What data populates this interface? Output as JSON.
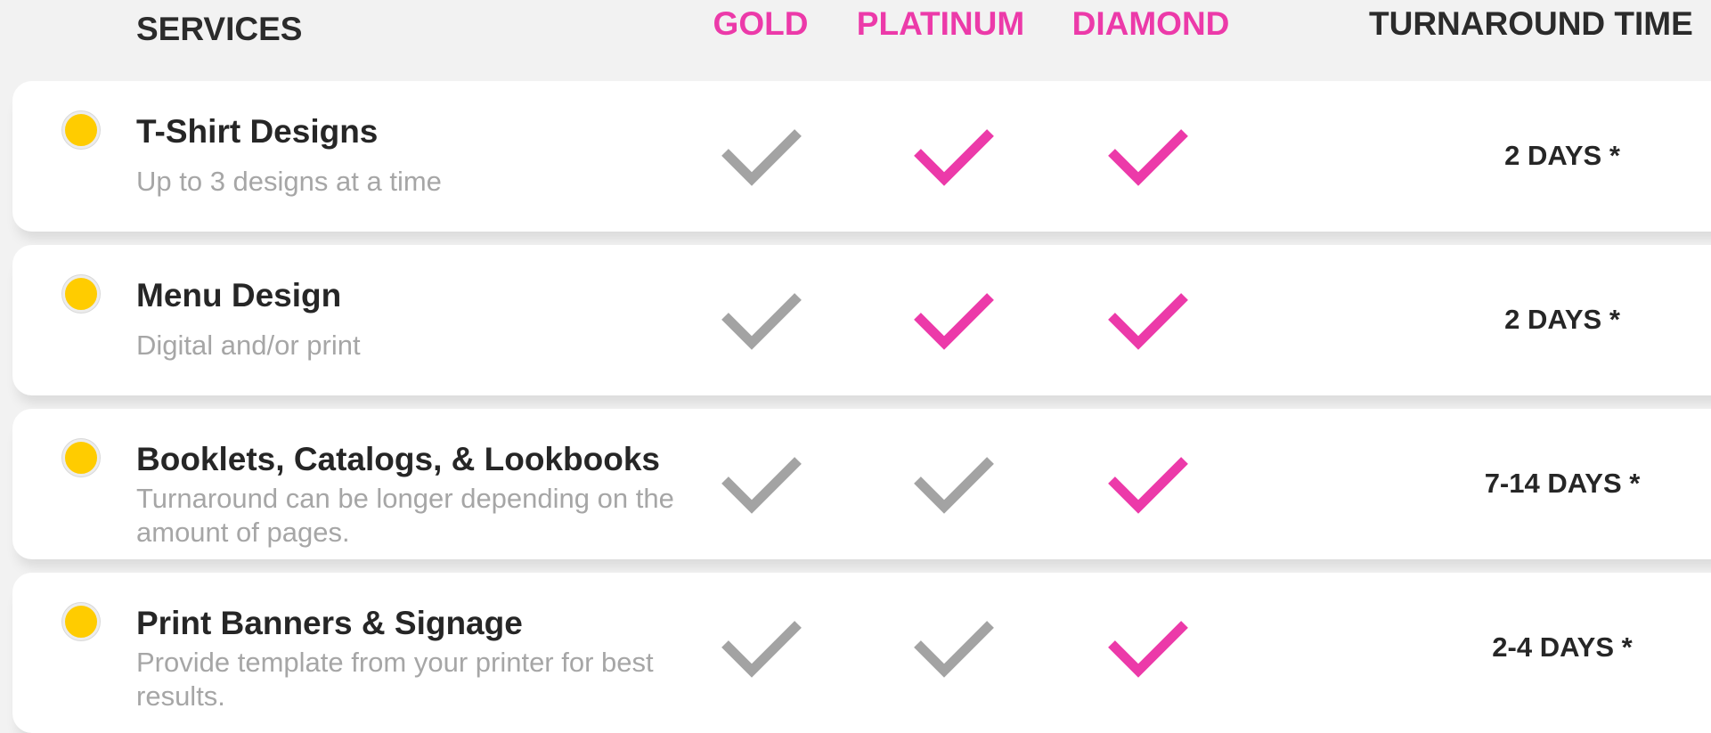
{
  "header": {
    "services": "SERVICES",
    "gold": "GOLD",
    "platinum": "PLATINUM",
    "diamond": "DIAMOND",
    "turnaround": "TURNAROUND TIME"
  },
  "colors": {
    "accent_pink": "#ec3aa9",
    "check_gray": "#a3a3a3",
    "bullet_yellow": "#ffcc00"
  },
  "rows": [
    {
      "title": "T-Shirt Designs",
      "subtitle": "Up to 3 designs at a time",
      "gold": "included-gray",
      "platinum": "included-pink",
      "diamond": "included-pink",
      "turnaround": "2 DAYS *"
    },
    {
      "title": "Menu Design",
      "subtitle": "Digital and/or print",
      "gold": "included-gray",
      "platinum": "included-pink",
      "diamond": "included-pink",
      "turnaround": "2 DAYS *"
    },
    {
      "title": "Booklets, Catalogs, & Lookbooks",
      "subtitle": "Turnaround can be longer depending on the amount of pages.",
      "gold": "included-gray",
      "platinum": "included-gray",
      "diamond": "included-pink",
      "turnaround": "7-14 DAYS *"
    },
    {
      "title": "Print Banners & Signage",
      "subtitle": "Provide template from your printer for best results.",
      "gold": "included-gray",
      "platinum": "included-gray",
      "diamond": "included-pink",
      "turnaround": "2-4 DAYS *"
    }
  ]
}
